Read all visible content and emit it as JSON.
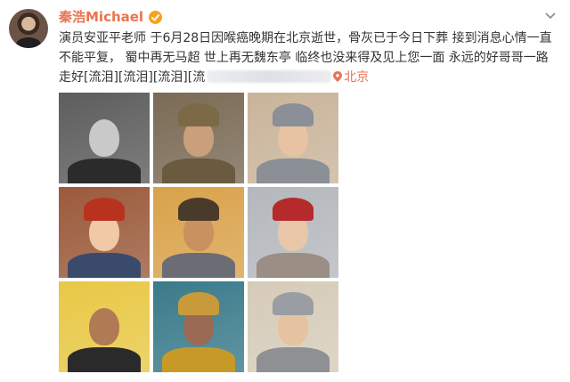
{
  "user": {
    "name": "秦浩Michael"
  },
  "post": {
    "text_main": "演员安亚平老师 于6月28日因喉癌晚期在北京逝世，骨灰已于今日下葬 接到消息心情一直不能平复， 蜀中再无马超 世上再无魏东亭 临终也没来得及见上您一面 永远的好哥哥一路走好[流泪][流泪][流泪][流",
    "location": "北京"
  },
  "photos": [
    {
      "bg": "#5d5d5d",
      "face": "#c9c9c9",
      "body": "#2b2b2b",
      "hat": ""
    },
    {
      "bg": "#7a6a55",
      "face": "#c9a07a",
      "body": "#6a5a40",
      "hat": "#7b6a45"
    },
    {
      "bg": "#c9b49a",
      "face": "#e7c3a3",
      "body": "#8b8f96",
      "hat": "#8a8f98"
    },
    {
      "bg": "#9a5a3a",
      "face": "#f0c9a6",
      "body": "#3a4a6a",
      "hat": "#b8321f"
    },
    {
      "bg": "#d9a24a",
      "face": "#c8915f",
      "body": "#6a6d74",
      "hat": "#4a3a2a"
    },
    {
      "bg": "#b4b8bd",
      "face": "#e9c7a8",
      "body": "#9a8e85",
      "hat": "#b52a2a"
    },
    {
      "bg": "#e8c845",
      "face": "#b07a55",
      "body": "#2a2a2a",
      "hat": ""
    },
    {
      "bg": "#3a7a8a",
      "face": "#9a6a55",
      "body": "#c79a28",
      "hat": "#c89a3a"
    },
    {
      "bg": "#d6cbb8",
      "face": "#e5c2a0",
      "body": "#8e9094",
      "hat": "#9a9ea4"
    }
  ]
}
